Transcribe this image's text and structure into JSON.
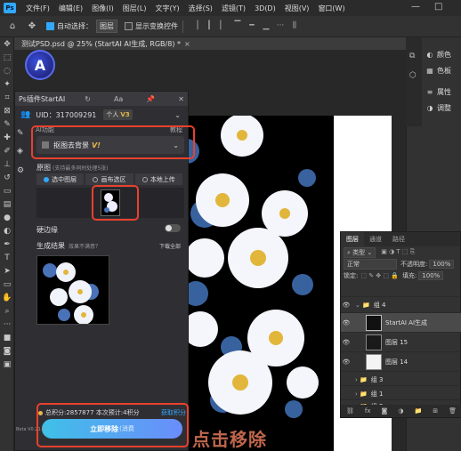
{
  "menubar": {
    "logo": "Ps",
    "items": [
      "文件(F)",
      "编辑(E)",
      "图像(I)",
      "图层(L)",
      "文字(Y)",
      "选择(S)",
      "滤镜(T)",
      "3D(D)",
      "视图(V)",
      "窗口(W)"
    ],
    "minimize": "—",
    "maximize": "□"
  },
  "optionsbar": {
    "auto_select_label": "自动选择：",
    "auto_select_value": "图层",
    "show_transform_label": "显示变换控件"
  },
  "document": {
    "tab_title": "测试PSD.psd @ 25% (StartAI AI生成, RGB/8) *",
    "close": "×"
  },
  "plugin": {
    "logo": "A",
    "title": "Ps插件StartAI",
    "uid": "UID：317009291",
    "account_type": "个人",
    "vip_badge": "V3",
    "function_label": "AI功能",
    "function_right": "教程",
    "function_value": "抠图去背景",
    "function_vip": "V!",
    "source_title": "原图",
    "source_hint": "(支持最多同时处理5张)",
    "source_tabs": [
      "选中图层",
      "画布选区",
      "本地上传"
    ],
    "hard_edge_label": "硬边缘",
    "result_title": "生成结果",
    "result_hint": "效果不满意？",
    "download_all": "下载全部",
    "points": "总积分:2857877  本次预计:4积分",
    "get_points": "获取积分",
    "go_button": "立即移除",
    "go_button_sub": "(消费",
    "version": "Beta\nV0.21.8"
  },
  "rightpanel": {
    "items": [
      "颜色",
      "色板",
      "属性",
      "调整"
    ]
  },
  "layers": {
    "tabs": [
      "图层",
      "通道",
      "路径"
    ],
    "filter_label": "类型",
    "blend_mode": "正常",
    "opacity_label": "不透明度:",
    "opacity_value": "100%",
    "lock_label": "锁定:",
    "fill_label": "填充:",
    "fill_value": "100%",
    "rows": [
      {
        "name": "组 4",
        "kind": "group"
      },
      {
        "name": "StartAI AI生成",
        "kind": "layer"
      },
      {
        "name": "图层 15",
        "kind": "layer"
      },
      {
        "name": "图层 14",
        "kind": "layer"
      },
      {
        "name": "组 3",
        "kind": "group"
      },
      {
        "name": "组 1",
        "kind": "group"
      },
      {
        "name": "组 2",
        "kind": "group"
      }
    ]
  },
  "watermark": "点击移除",
  "colors": {
    "highlight": "#e8412d",
    "accent": "#31a8ff",
    "button_start": "#3fc0e8",
    "button_end": "#6b8dfb"
  }
}
